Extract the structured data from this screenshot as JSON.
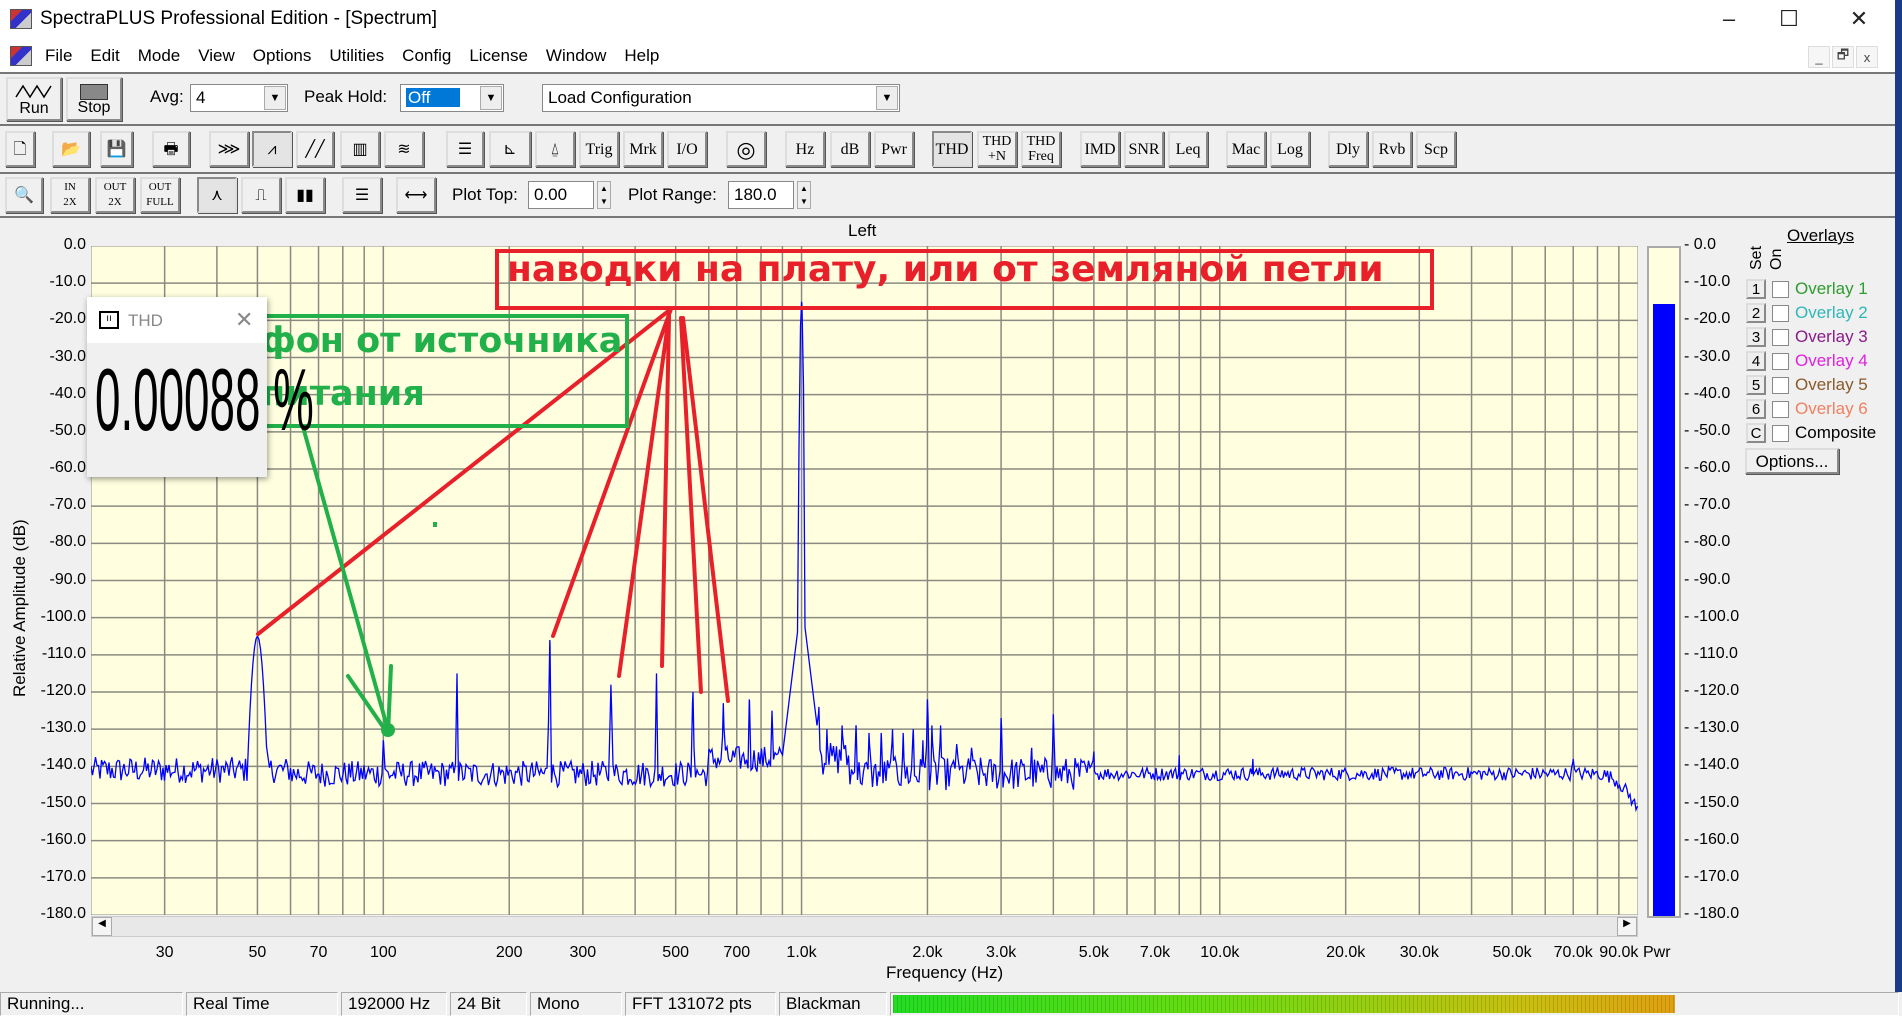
{
  "window": {
    "title": "SpectraPLUS Professional Edition - [Spectrum]",
    "minimize": "–",
    "maximize": "☐",
    "close": "✕"
  },
  "mdi": {
    "minimize": "_",
    "restore": "🗗",
    "close": "x"
  },
  "menu": [
    "File",
    "Edit",
    "Mode",
    "View",
    "Options",
    "Utilities",
    "Config",
    "License",
    "Window",
    "Help"
  ],
  "toolbar1": {
    "run": "Run",
    "stop": "Stop",
    "avg_label": "Avg:",
    "avg_value": "4",
    "peak_hold_label": "Peak Hold:",
    "peak_hold_value": "Off",
    "config_value": "Load Configuration"
  },
  "toolbar2": {
    "text_buttons": [
      "Trig",
      "Mrk",
      "I/O",
      "Hz",
      "dB",
      "Pwr",
      "THD",
      "THD +N",
      "THD Freq",
      "IMD",
      "SNR",
      "Leq",
      "Mac",
      "Log",
      "Dly",
      "Rvb",
      "Scp"
    ]
  },
  "toolbar3": {
    "plot_top_label": "Plot Top:",
    "plot_top_value": "0.00",
    "plot_range_label": "Plot Range:",
    "plot_range_value": "180.0"
  },
  "chart_data": {
    "type": "line",
    "title": "Left",
    "xlabel": "Frequency (Hz)",
    "ylabel": "Relative Amplitude (dB)",
    "xscale": "log",
    "xlim": [
      20,
      100000
    ],
    "ylim": [
      -180,
      0
    ],
    "grid": true,
    "yticks": [
      "0.0",
      "-10.0",
      "-20.0",
      "-30.0",
      "-40.0",
      "-50.0",
      "-60.0",
      "-70.0",
      "-80.0",
      "-90.0",
      "-100.0",
      "-110.0",
      "-120.0",
      "-130.0",
      "-140.0",
      "-150.0",
      "-160.0",
      "-170.0",
      "-180.0"
    ],
    "xticks": [
      {
        "v": 30,
        "t": "30"
      },
      {
        "v": 50,
        "t": "50"
      },
      {
        "v": 70,
        "t": "70"
      },
      {
        "v": 100,
        "t": "100"
      },
      {
        "v": 200,
        "t": "200"
      },
      {
        "v": 300,
        "t": "300"
      },
      {
        "v": 500,
        "t": "500"
      },
      {
        "v": 700,
        "t": "700"
      },
      {
        "v": 1000,
        "t": "1.0k"
      },
      {
        "v": 2000,
        "t": "2.0k"
      },
      {
        "v": 3000,
        "t": "3.0k"
      },
      {
        "v": 5000,
        "t": "5.0k"
      },
      {
        "v": 7000,
        "t": "7.0k"
      },
      {
        "v": 10000,
        "t": "10.0k"
      },
      {
        "v": 20000,
        "t": "20.0k"
      },
      {
        "v": 30000,
        "t": "30.0k"
      },
      {
        "v": 50000,
        "t": "50.0k"
      },
      {
        "v": 70000,
        "t": "70.0k"
      },
      {
        "v": 90000,
        "t": "90.0k"
      }
    ],
    "noise_floor_db": -142,
    "series": [
      {
        "name": "Left",
        "color": "#0000ff",
        "peaks": [
          [
            50,
            -105
          ],
          [
            100,
            -133
          ],
          [
            150,
            -115
          ],
          [
            250,
            -106
          ],
          [
            350,
            -118
          ],
          [
            450,
            -115
          ],
          [
            550,
            -120
          ],
          [
            650,
            -123
          ],
          [
            750,
            -122
          ],
          [
            850,
            -125
          ],
          [
            1000,
            -15
          ],
          [
            1050,
            -127
          ],
          [
            1100,
            -124
          ],
          [
            1150,
            -130
          ],
          [
            1250,
            -129
          ],
          [
            1350,
            -129
          ],
          [
            1450,
            -131
          ],
          [
            1550,
            -131
          ],
          [
            1650,
            -130
          ],
          [
            1750,
            -131
          ],
          [
            1850,
            -130
          ],
          [
            1950,
            -133
          ],
          [
            2000,
            -122
          ],
          [
            2050,
            -129
          ],
          [
            2150,
            -129
          ],
          [
            2350,
            -134
          ],
          [
            2550,
            -135
          ],
          [
            3000,
            -127
          ],
          [
            3550,
            -135
          ],
          [
            4000,
            -126
          ],
          [
            5000,
            -136
          ],
          [
            8000,
            -137
          ],
          [
            12000,
            -138
          ],
          [
            70000,
            -138
          ]
        ]
      }
    ]
  },
  "thd_popup": {
    "title": "THD",
    "value": "0.00088 %"
  },
  "power_meter": {
    "label": "Pwr",
    "level_db": -15,
    "scale": [
      "0.0",
      "-10.0",
      "-20.0",
      "-30.0",
      "-40.0",
      "-50.0",
      "-60.0",
      "-70.0",
      "-80.0",
      "-90.0",
      "-100.0",
      "-110.0",
      "-120.0",
      "-130.0",
      "-140.0",
      "-150.0",
      "-160.0",
      "-170.0",
      "-180.0"
    ],
    "color": "#0000ff"
  },
  "overlays": {
    "title": "Overlays",
    "set_label": "Set",
    "on_label": "On",
    "items": [
      {
        "key": "1",
        "label": "Overlay 1",
        "color": "#2e9c2e"
      },
      {
        "key": "2",
        "label": "Overlay 2",
        "color": "#2fb7b7"
      },
      {
        "key": "3",
        "label": "Overlay 3",
        "color": "#8a1a8a"
      },
      {
        "key": "4",
        "label": "Overlay 4",
        "color": "#e020e0"
      },
      {
        "key": "5",
        "label": "Overlay 5",
        "color": "#8a5a2a"
      },
      {
        "key": "6",
        "label": "Overlay 6",
        "color": "#f08060"
      },
      {
        "key": "C",
        "label": "Composite",
        "color": "#000000"
      }
    ],
    "options": "Options..."
  },
  "annotations": {
    "red_text": "наводки на плату, или от земляной петли",
    "green_line1": "фон от источника",
    "green_line2": "питания"
  },
  "status": [
    "Running...",
    "Real Time",
    "192000 Hz",
    "24 Bit",
    "Mono",
    "FFT 131072 pts",
    "Blackman"
  ],
  "input_level_fraction": 0.78
}
